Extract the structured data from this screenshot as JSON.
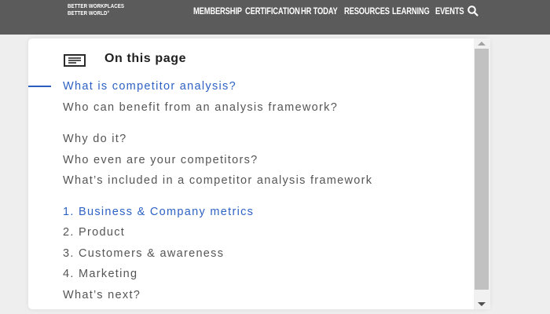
{
  "header": {
    "logo_lines": [
      "BETTER WORKPLACES",
      "BETTER WORLD°"
    ],
    "nav": [
      "MEMBERSHIP",
      "CERTIFICATION",
      "HR TODAY",
      "RESOURCES",
      "LEARNING",
      "EVENTS"
    ],
    "search_icon": "search-icon"
  },
  "toc": {
    "title": "On this page",
    "icon": "list-icon",
    "active_color": "#2e62c4",
    "items": [
      "What is competitor analysis?",
      "Who can benefit from an analysis framework?",
      "Why do it?",
      "Who even are your competitors?",
      "What’s included in a competitor analysis framework",
      "1. Business & Company metrics",
      "2. Product",
      "3. Customers & awareness",
      "4. Marketing",
      "What’s next?"
    ]
  }
}
